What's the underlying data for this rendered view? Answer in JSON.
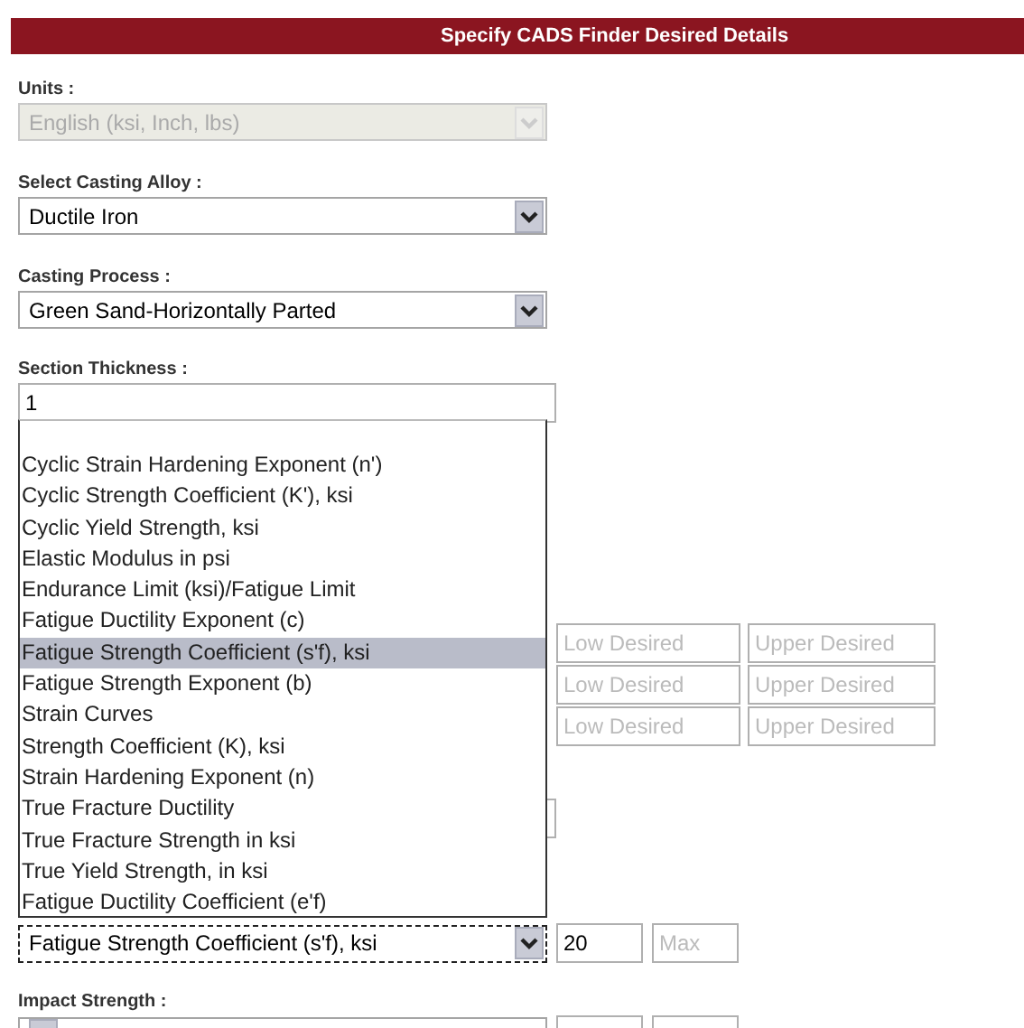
{
  "header": {
    "title": "Specify CADS Finder Desired Details"
  },
  "units": {
    "label": "Units :",
    "value": "English (ksi, Inch, lbs)",
    "disabled": true
  },
  "alloy": {
    "label": "Select Casting Alloy :",
    "value": "Ductile Iron",
    "disabled": false
  },
  "process": {
    "label": "Casting Process :",
    "value": "Green Sand-Horizontally Parted",
    "disabled": false
  },
  "thickness": {
    "label": "Section Thickness :",
    "value": "1"
  },
  "desired_rows": [
    {
      "low_placeholder": "Low Desired",
      "upper_placeholder": "Upper Desired"
    },
    {
      "low_placeholder": "Low Desired",
      "upper_placeholder": "Upper Desired"
    },
    {
      "low_placeholder": "Low Desired",
      "upper_placeholder": "Upper Desired"
    }
  ],
  "property": {
    "value": "Fatigue Strength Coefficient (s'f), ksi",
    "focused": true,
    "min_value": "20",
    "max_placeholder": "Max"
  },
  "impact": {
    "label": "Impact Strength :"
  },
  "dropdown": {
    "options": [
      {
        "label": "Cyclic Strain Hardening Exponent (n')",
        "selected": false
      },
      {
        "label": "Cyclic Strength Coefficient (K'), ksi",
        "selected": false
      },
      {
        "label": "Cyclic Yield Strength, ksi",
        "selected": false
      },
      {
        "label": "Elastic Modulus in psi",
        "selected": false
      },
      {
        "label": "Endurance Limit (ksi)/Fatigue Limit",
        "selected": false
      },
      {
        "label": "Fatigue Ductility Exponent (c)",
        "selected": false
      },
      {
        "label": "Fatigue Strength Coefficient (s'f), ksi",
        "selected": true
      },
      {
        "label": "Fatigue Strength Exponent (b)",
        "selected": false
      },
      {
        "label": "Strain Curves",
        "selected": false
      },
      {
        "label": "Strength Coefficient (K), ksi",
        "selected": false
      },
      {
        "label": "Strain Hardening Exponent (n)",
        "selected": false
      },
      {
        "label": "True Fracture Ductility",
        "selected": false
      },
      {
        "label": "True Fracture Strength in ksi",
        "selected": false
      },
      {
        "label": "True Yield Strength, in ksi",
        "selected": false
      },
      {
        "label": "Fatigue Ductility Coefficient (e'f)",
        "selected": false
      }
    ]
  }
}
